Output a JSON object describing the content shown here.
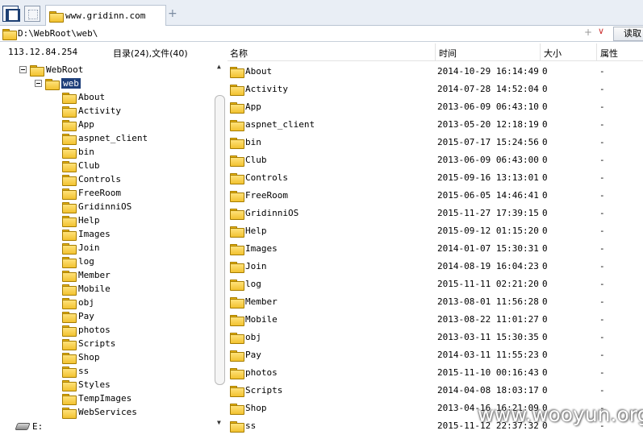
{
  "tab": {
    "title": "www.gridinn.com",
    "add": "+"
  },
  "address": {
    "path": "D:\\WebRoot\\web\\",
    "plus": "+",
    "dropdown": "∨",
    "read_label": "读取"
  },
  "info": {
    "ip": "113.12.84.254",
    "count": "目录(24),文件(40)"
  },
  "tree": {
    "root": "WebRoot",
    "current": "web",
    "children": [
      "About",
      "Activity",
      "App",
      "aspnet_client",
      "bin",
      "Club",
      "Controls",
      "FreeRoom",
      "GridinniOS",
      "Help",
      "Images",
      "Join",
      "log",
      "Member",
      "Mobile",
      "obj",
      "Pay",
      "photos",
      "Scripts",
      "Shop",
      "ss",
      "Styles",
      "TempImages",
      "WebServices"
    ],
    "drive": "E:"
  },
  "columns": {
    "name": "名称",
    "time": "时间",
    "size": "大小",
    "attr": "属性"
  },
  "files": [
    {
      "name": "About",
      "time": "2014-10-29 16:14:49",
      "size": "0",
      "attr": "-"
    },
    {
      "name": "Activity",
      "time": "2014-07-28 14:52:04",
      "size": "0",
      "attr": "-"
    },
    {
      "name": "App",
      "time": "2013-06-09 06:43:10",
      "size": "0",
      "attr": "-"
    },
    {
      "name": "aspnet_client",
      "time": "2013-05-20 12:18:19",
      "size": "0",
      "attr": "-"
    },
    {
      "name": "bin",
      "time": "2015-07-17 15:24:56",
      "size": "0",
      "attr": "-"
    },
    {
      "name": "Club",
      "time": "2013-06-09 06:43:00",
      "size": "0",
      "attr": "-"
    },
    {
      "name": "Controls",
      "time": "2015-09-16 13:13:01",
      "size": "0",
      "attr": "-"
    },
    {
      "name": "FreeRoom",
      "time": "2015-06-05 14:46:41",
      "size": "0",
      "attr": "-"
    },
    {
      "name": "GridinniOS",
      "time": "2015-11-27 17:39:15",
      "size": "0",
      "attr": "-"
    },
    {
      "name": "Help",
      "time": "2015-09-12 01:15:20",
      "size": "0",
      "attr": "-"
    },
    {
      "name": "Images",
      "time": "2014-01-07 15:30:31",
      "size": "0",
      "attr": "-"
    },
    {
      "name": "Join",
      "time": "2014-08-19 16:04:23",
      "size": "0",
      "attr": "-"
    },
    {
      "name": "log",
      "time": "2015-11-11 02:21:20",
      "size": "0",
      "attr": "-"
    },
    {
      "name": "Member",
      "time": "2013-08-01 11:56:28",
      "size": "0",
      "attr": "-"
    },
    {
      "name": "Mobile",
      "time": "2013-08-22 11:01:27",
      "size": "0",
      "attr": "-"
    },
    {
      "name": "obj",
      "time": "2013-03-11 15:30:35",
      "size": "0",
      "attr": "-"
    },
    {
      "name": "Pay",
      "time": "2014-03-11 11:55:23",
      "size": "0",
      "attr": "-"
    },
    {
      "name": "photos",
      "time": "2015-11-10 00:16:43",
      "size": "0",
      "attr": "-"
    },
    {
      "name": "Scripts",
      "time": "2014-04-08 18:03:17",
      "size": "0",
      "attr": "-"
    },
    {
      "name": "Shop",
      "time": "2013-04-16 16:21:09",
      "size": "0",
      "attr": "-"
    },
    {
      "name": "ss",
      "time": "2015-11-12 22:37:32",
      "size": "0",
      "attr": "-"
    }
  ],
  "watermark": "www.wooyun.org"
}
